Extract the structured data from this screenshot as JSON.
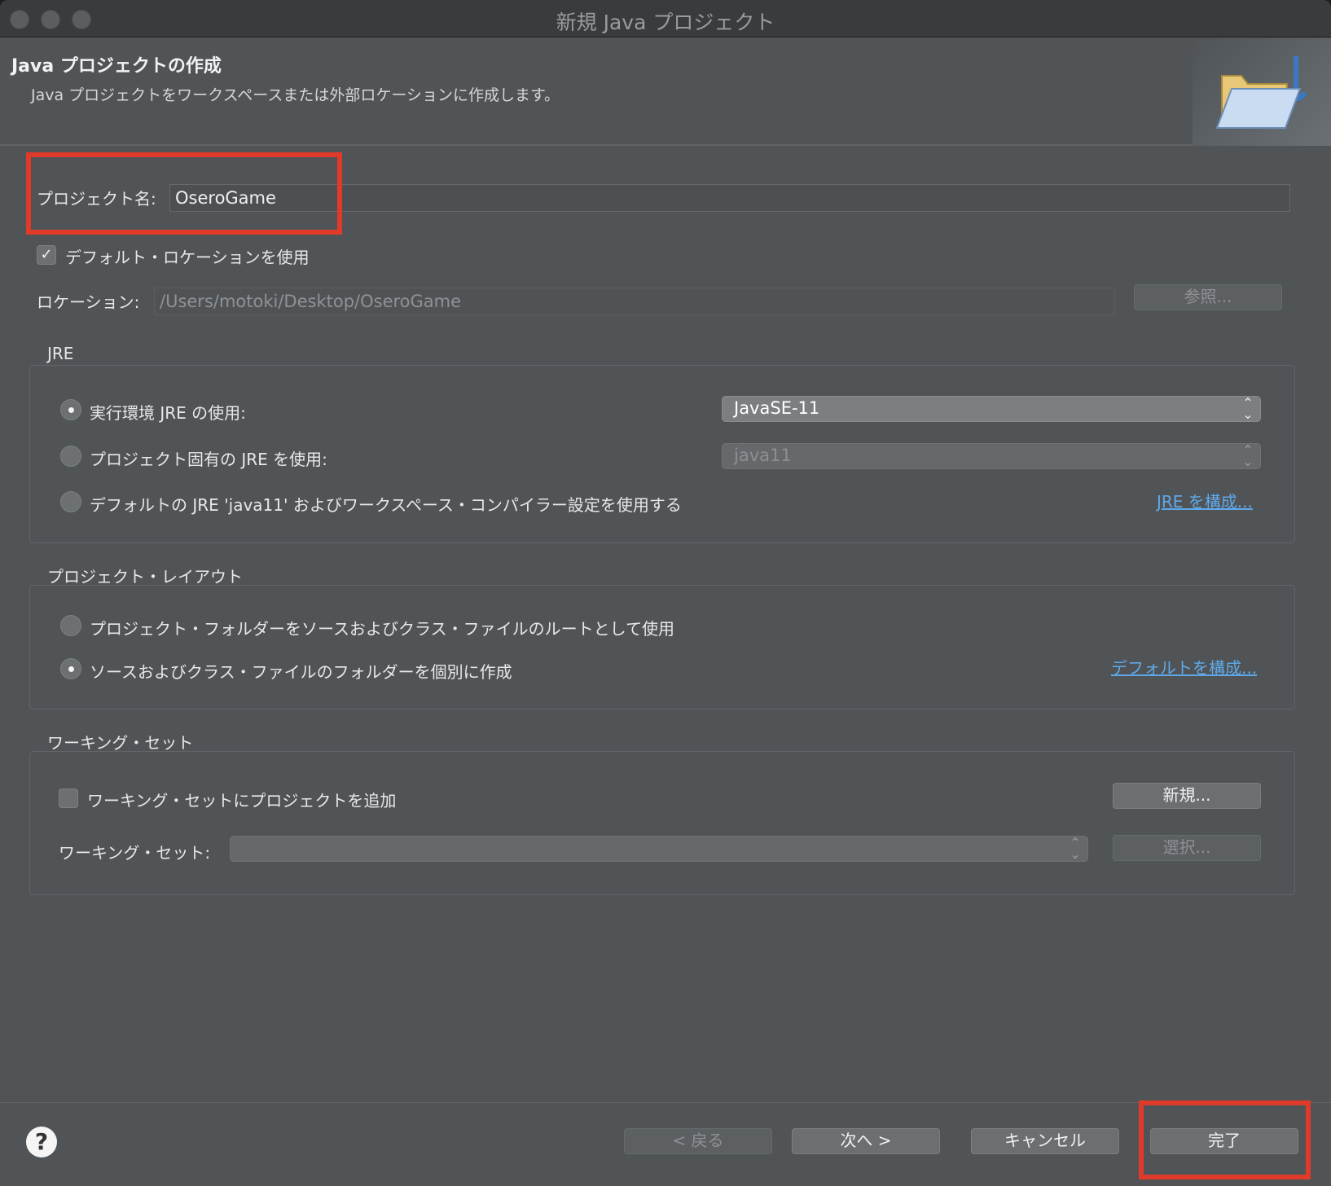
{
  "window": {
    "title": "新規 Java プロジェクト"
  },
  "header": {
    "title": "Java プロジェクトの作成",
    "description": "Java プロジェクトをワークスペースまたは外部ロケーションに作成します。",
    "banner_icon": "folder-icon"
  },
  "project": {
    "name_label": "プロジェクト名:",
    "name_value": "OseroGame",
    "use_default_location_label": "デフォルト・ロケーションを使用",
    "use_default_location_checked": true,
    "location_label": "ロケーション:",
    "location_value": "/Users/motoki/Desktop/OseroGame",
    "browse_label": "参照..."
  },
  "jre": {
    "group_title": "JRE",
    "option_execution_env": "実行環境 JRE の使用:",
    "execution_env_value": "JavaSE-11",
    "option_project_specific": "プロジェクト固有の JRE を使用:",
    "project_specific_value": "java11",
    "option_default": "デフォルトの JRE 'java11' およびワークスペース・コンパイラー設定を使用する",
    "configure_link": "JRE を構成...",
    "selected": "execution_env"
  },
  "layout": {
    "group_title": "プロジェクト・レイアウト",
    "option_project_folder": "プロジェクト・フォルダーをソースおよびクラス・ファイルのルートとして使用",
    "option_separate": "ソースおよびクラス・ファイルのフォルダーを個別に作成",
    "configure_link": "デフォルトを構成...",
    "selected": "separate"
  },
  "working_sets": {
    "group_title": "ワーキング・セット",
    "add_label": "ワーキング・セットにプロジェクトを追加",
    "add_checked": false,
    "new_button": "新規...",
    "sets_label": "ワーキング・セット:",
    "sets_value": "",
    "select_button": "選択..."
  },
  "footer": {
    "help_symbol": "?",
    "back_button": "< 戻る",
    "next_button": "次へ >",
    "cancel_button": "キャンセル",
    "finish_button": "完了"
  },
  "colors": {
    "highlight": "#e03a2a",
    "link": "#5fa8e8",
    "background": "#505457"
  }
}
